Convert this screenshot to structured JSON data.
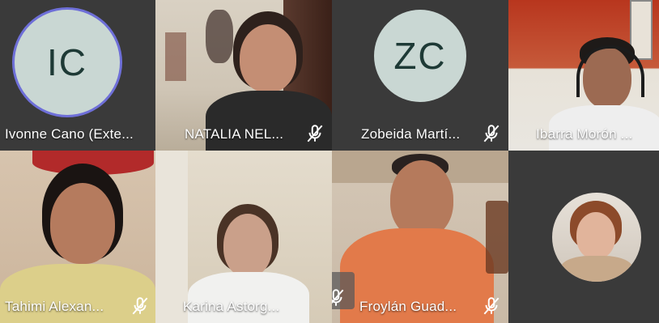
{
  "participants": [
    {
      "name": "Ivonne Cano (Exte...",
      "initials": "IC",
      "muted": false,
      "video": false
    },
    {
      "name": "NATALIA NEL...",
      "muted": true,
      "video": true
    },
    {
      "name": "Zobeida Martí...",
      "initials": "ZC",
      "muted": true,
      "video": false
    },
    {
      "name": "Ibarra Morón ...",
      "muted": false,
      "video": true
    },
    {
      "name": "Tahimi Alexan...",
      "muted": true,
      "video": true
    },
    {
      "name": "Karina Astorg...",
      "muted": false,
      "video": true
    },
    {
      "name": "Froylán Guad...",
      "muted": true,
      "video": true
    },
    {
      "name": "",
      "muted": false,
      "video": false,
      "avatar": "profile-photo"
    }
  ],
  "colors": {
    "tile_dark": "#3a3a3a",
    "initials_bg": "#c9d7d3",
    "initials_text": "#1e3a36",
    "active_speaker_ring": "#6e6fd8"
  },
  "icons": {
    "muted": "mic-off-icon"
  }
}
